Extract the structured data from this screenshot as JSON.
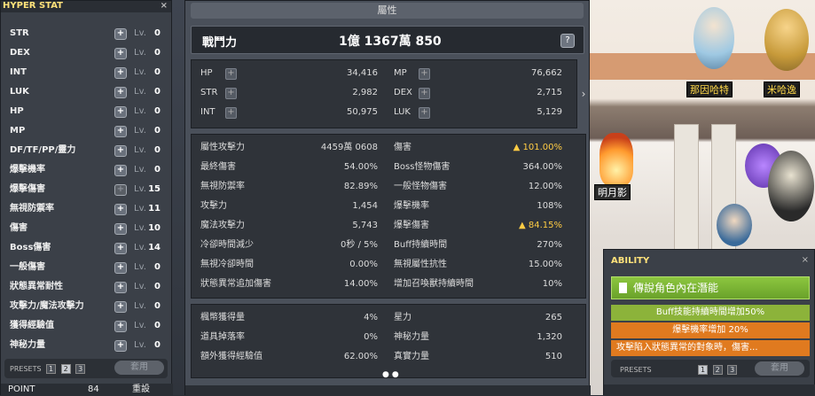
{
  "hyper_stat": {
    "title": "HYPER STAT",
    "close": "×",
    "rows": [
      {
        "label": "STR",
        "lv": "Lv.",
        "level": "0"
      },
      {
        "label": "DEX",
        "lv": "Lv.",
        "level": "0"
      },
      {
        "label": "INT",
        "lv": "Lv.",
        "level": "0"
      },
      {
        "label": "LUK",
        "lv": "Lv.",
        "level": "0"
      },
      {
        "label": "HP",
        "lv": "Lv.",
        "level": "0"
      },
      {
        "label": "MP",
        "lv": "Lv.",
        "level": "0"
      },
      {
        "label": "DF/TF/PP/靈力",
        "lv": "Lv.",
        "level": "0"
      },
      {
        "label": "爆擊機率",
        "lv": "Lv.",
        "level": "0"
      },
      {
        "label": "爆擊傷害",
        "lv": "Lv.",
        "level": "15"
      },
      {
        "label": "無視防禦率",
        "lv": "Lv.",
        "level": "11"
      },
      {
        "label": "傷害",
        "lv": "Lv.",
        "level": "10"
      },
      {
        "label": "Boss傷害",
        "lv": "Lv.",
        "level": "14"
      },
      {
        "label": "一般傷害",
        "lv": "Lv.",
        "level": "0"
      },
      {
        "label": "狀態異常耐性",
        "lv": "Lv.",
        "level": "0"
      },
      {
        "label": "攻擊力/魔法攻擊力",
        "lv": "Lv.",
        "level": "0"
      },
      {
        "label": "獲得經驗值",
        "lv": "Lv.",
        "level": "0"
      },
      {
        "label": "神秘力量",
        "lv": "Lv.",
        "level": "0"
      }
    ],
    "presets_label": "PRESETS",
    "presets": [
      "1",
      "2",
      "3"
    ],
    "selected_preset": "2",
    "apply": "套用",
    "bottom_left": "POINT",
    "bottom_value": "84",
    "bottom_btn": "重設"
  },
  "stat": {
    "title": "屬性",
    "combat_label": "戰鬥力",
    "combat_value": "1億 1367萬 850",
    "help": "?",
    "basic": [
      {
        "k": "HP",
        "v": "34,416"
      },
      {
        "k": "MP",
        "v": "76,662"
      },
      {
        "k": "STR",
        "v": "2,982"
      },
      {
        "k": "DEX",
        "v": "2,715"
      },
      {
        "k": "INT",
        "v": "50,975"
      },
      {
        "k": "LUK",
        "v": "5,129"
      }
    ],
    "advanced": [
      {
        "k": "屬性攻擊力",
        "v": "4459萬 0608"
      },
      {
        "k": "傷害",
        "v": "▲ 101.00%"
      },
      {
        "k": "最終傷害",
        "v": "54.00%"
      },
      {
        "k": "Boss怪物傷害",
        "v": "364.00%"
      },
      {
        "k": "無視防禦率",
        "v": "82.89%"
      },
      {
        "k": "一般怪物傷害",
        "v": "12.00%"
      },
      {
        "k": "攻擊力",
        "v": "1,454"
      },
      {
        "k": "爆擊機率",
        "v": "108%"
      },
      {
        "k": "魔法攻擊力",
        "v": "5,743"
      },
      {
        "k": "爆擊傷害",
        "v": "▲ 84.15%"
      },
      {
        "k": "冷卻時間減少",
        "v": "0秒 / 5%"
      },
      {
        "k": "Buff持續時間",
        "v": "270%"
      },
      {
        "k": "無視冷卻時間",
        "v": "0.00%"
      },
      {
        "k": "無視屬性抗性",
        "v": "15.00%"
      },
      {
        "k": "狀態異常追加傷害",
        "v": "14.00%"
      },
      {
        "k": "增加召喚獸持續時間",
        "v": "10%"
      }
    ],
    "misc": [
      {
        "k": "楓幣獲得量",
        "v": "4%"
      },
      {
        "k": "星力",
        "v": "265"
      },
      {
        "k": "道具掉落率",
        "v": "0%"
      },
      {
        "k": "神秘力量",
        "v": "1,320"
      },
      {
        "k": "額外獲得經驗值",
        "v": "62.00%"
      },
      {
        "k": "真實力量",
        "v": "510"
      }
    ],
    "page_dots": "●●",
    "arrow": "›"
  },
  "ability": {
    "title": "ABILITY",
    "close": "×",
    "grade": "傳說角色內在潛能",
    "lines": [
      "Buff技能持續時間增加50%",
      "爆擊機率增加 20%",
      "攻擊陷入狀態異常的對象時，傷害..."
    ],
    "presets_label": "PRESETS",
    "presets": [
      "1",
      "2",
      "3"
    ],
    "apply": "套用"
  },
  "scene": {
    "names": [
      "那因哈特",
      "米哈逸",
      "明月影"
    ]
  }
}
